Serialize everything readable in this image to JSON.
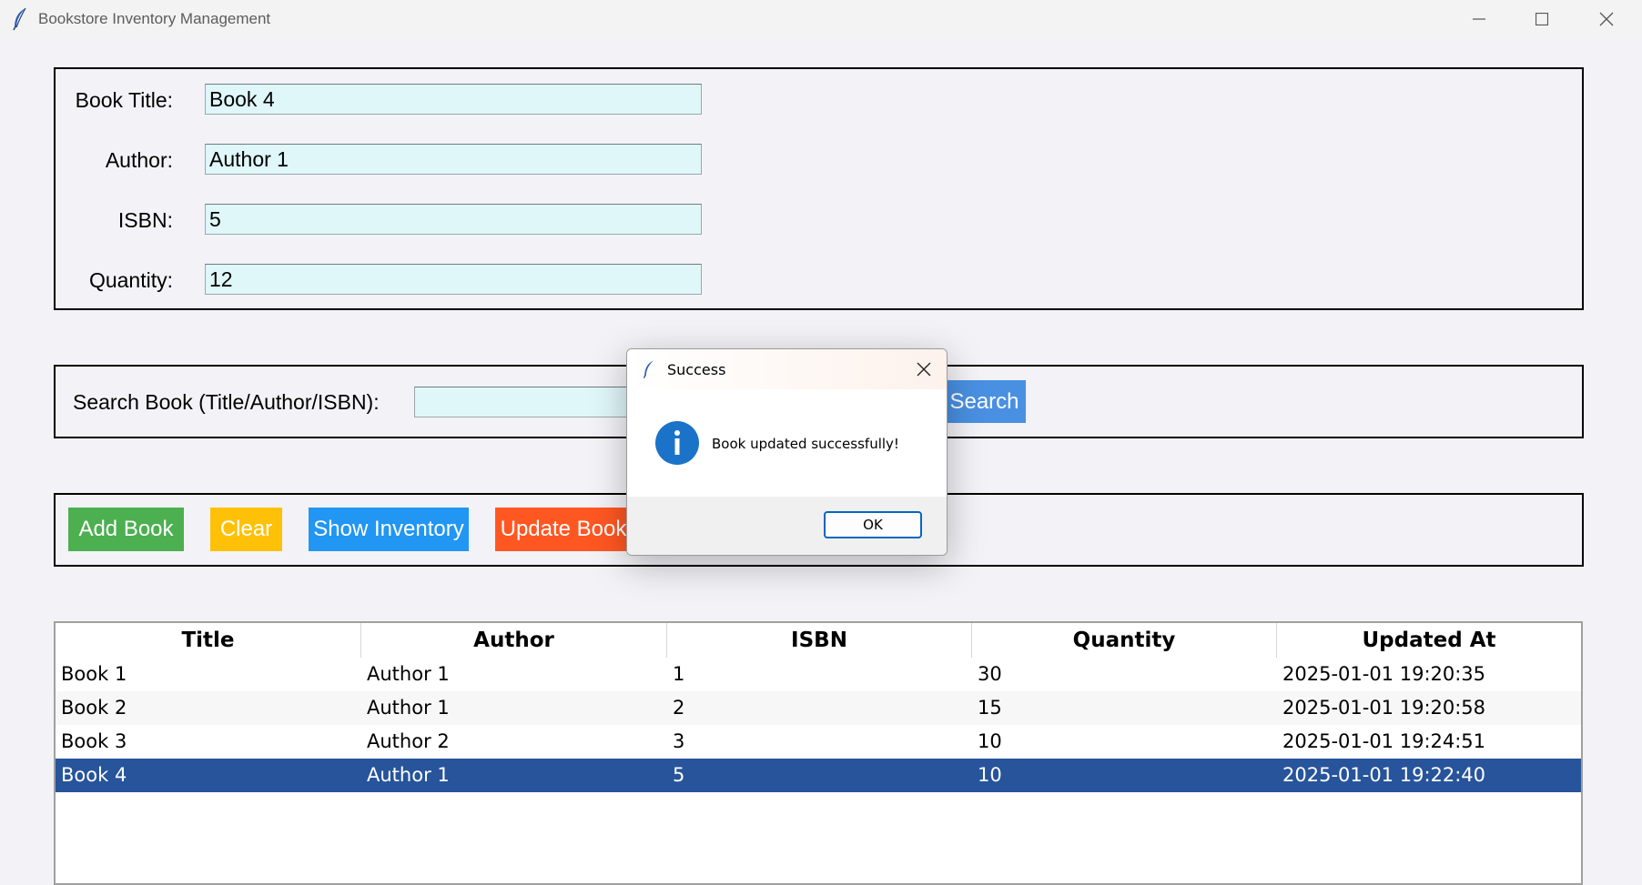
{
  "window": {
    "title": "Bookstore Inventory Management",
    "app_icon": "feather-icon",
    "controls": [
      "minimize-icon",
      "maximize-icon",
      "close-icon"
    ]
  },
  "form": {
    "title_label": "Book Title:",
    "title_value": "Book 4",
    "author_label": "Author:",
    "author_value": "Author 1",
    "isbn_label": "ISBN:",
    "isbn_value": "5",
    "quantity_label": "Quantity:",
    "quantity_value": "12"
  },
  "search": {
    "label": "Search Book (Title/Author/ISBN):",
    "value": "",
    "button": "Search"
  },
  "actions": {
    "add": "Add Book",
    "clear": "Clear",
    "show": "Show Inventory",
    "update": "Update Book"
  },
  "colors": {
    "add": "#4caf50",
    "clear": "#ffc107",
    "show": "#2196f3",
    "update": "#ff5722",
    "search": "#2196f3",
    "selected_row": "#27549b",
    "input_bg": "#e0f7fa"
  },
  "table": {
    "columns": [
      "Title",
      "Author",
      "ISBN",
      "Quantity",
      "Updated At"
    ],
    "rows": [
      [
        "Book 1",
        "Author 1",
        "1",
        "30",
        "2025-01-01 19:20:35"
      ],
      [
        "Book 2",
        "Author 1",
        "2",
        "15",
        "2025-01-01 19:20:58"
      ],
      [
        "Book 3",
        "Author 2",
        "3",
        "10",
        "2025-01-01 19:24:51"
      ],
      [
        "Book 4",
        "Author 1",
        "5",
        "10",
        "2025-01-01 19:22:40"
      ]
    ],
    "selected_index": 3
  },
  "dialog": {
    "title": "Success",
    "message": "Book updated successfully!",
    "ok": "OK",
    "icon": "info-icon"
  }
}
